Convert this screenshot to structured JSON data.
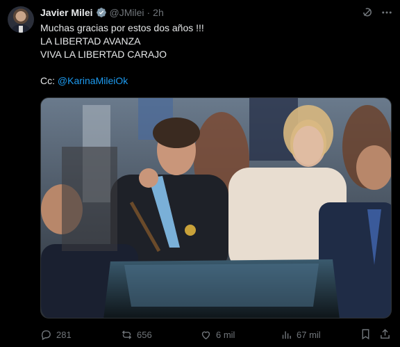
{
  "tweet": {
    "author_name": "Javier Milei",
    "handle": "@JMilei",
    "separator": "·",
    "time": "2h",
    "lines": [
      "Muchas gracias por estos dos años !!!",
      "LA LIBERTAD AVANZA",
      "VIVA LA LIBERTAD CARAJO"
    ],
    "cc_prefix": "Cc: ",
    "cc_mention": "@KarinaMileiOk"
  },
  "actions": {
    "replies": "281",
    "reposts": "656",
    "likes": "6 mil",
    "views": "67 mil"
  },
  "colors": {
    "background": "#000000",
    "text": "#e7e9ea",
    "muted": "#71767b",
    "accent": "#1d9bf0"
  },
  "icons": [
    "verified-badge-icon",
    "grok-icon",
    "more-icon",
    "reply-icon",
    "repost-icon",
    "like-icon",
    "views-icon",
    "bookmark-icon",
    "share-icon"
  ]
}
